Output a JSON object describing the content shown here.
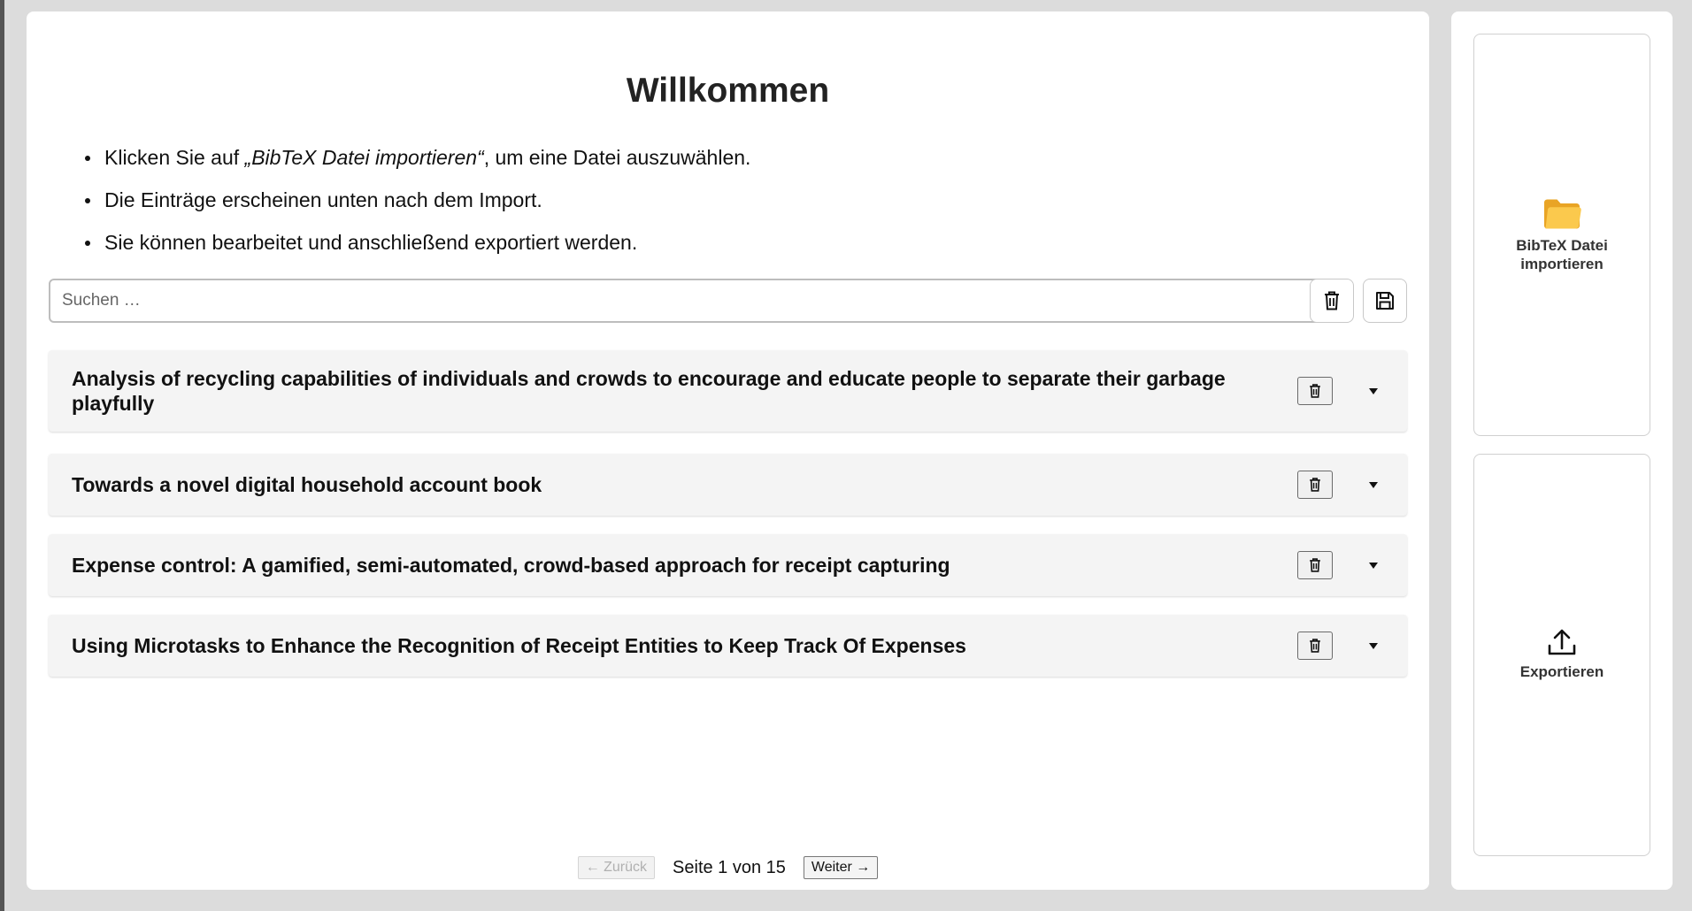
{
  "main": {
    "title": "Willkommen",
    "instructions": {
      "item1_pre": "Klicken Sie auf ",
      "item1_em": "„BibTeX Datei importieren“",
      "item1_post": ", um eine Datei auszuwählen.",
      "item2": "Die Einträge erscheinen unten nach dem Import.",
      "item3": "Sie können bearbeitet und anschließend exportiert werden."
    },
    "search": {
      "placeholder": "Suchen …",
      "value": ""
    },
    "toolbar": {
      "clear_icon": "trash-icon",
      "save_icon": "floppy-disk-icon"
    },
    "entries": [
      {
        "title": "Analysis of recycling capabilities of individuals and crowds to encourage and educate people to separate their garbage playfully"
      },
      {
        "title": "Towards a novel digital household account book"
      },
      {
        "title": "Expense control: A gamified, semi-automated, crowd-based approach for receipt capturing"
      },
      {
        "title": "Using Microtasks to Enhance the Recognition of Receipt Entities to Keep Track Of Expenses"
      }
    ],
    "pagination": {
      "prev_label": "← Zurück",
      "info": "Seite 1 von 15",
      "next_label": "Weiter →",
      "current_page": 1,
      "total_pages": 15
    }
  },
  "sidebar": {
    "import_label": "BibTeX Datei importieren",
    "import_icon": "folder-icon",
    "export_label": "Exportieren",
    "export_icon": "upload-icon"
  },
  "colors": {
    "background": "#dcdcdc",
    "card": "#ffffff",
    "entry_background": "#f4f4f4",
    "folder_icon": "#f7b633"
  }
}
